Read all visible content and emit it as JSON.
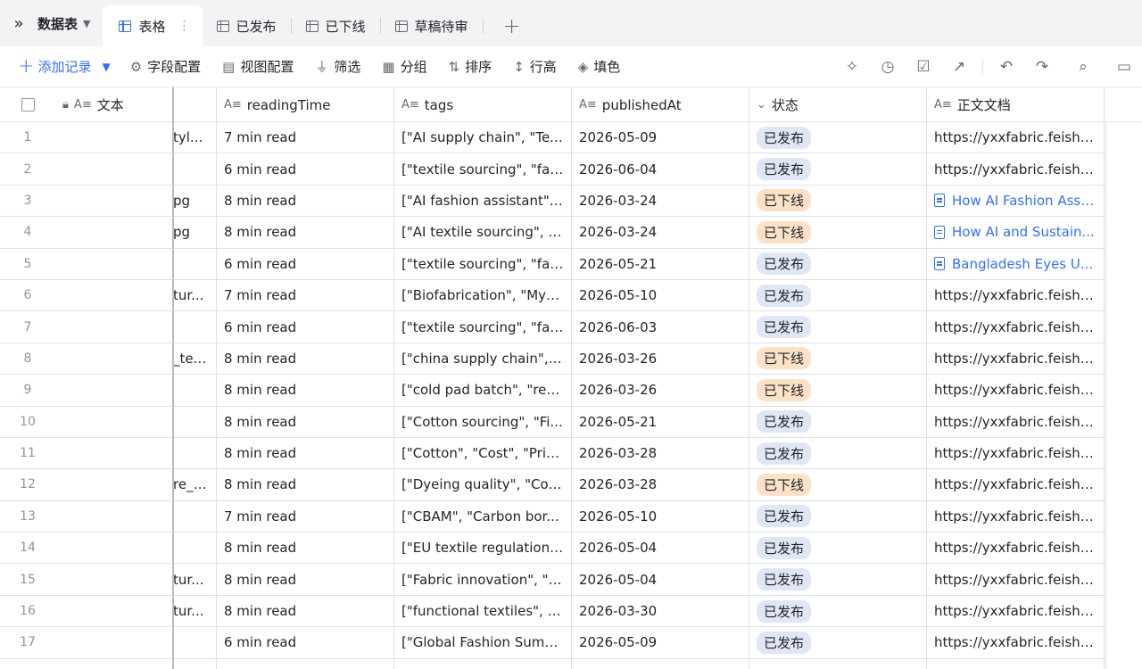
{
  "tabbar": {
    "expand_icon": "double-chevron-right-icon",
    "title": "数据表",
    "tabs": [
      {
        "label": "表格",
        "active": true
      },
      {
        "label": "已发布",
        "active": false
      },
      {
        "label": "已下线",
        "active": false
      },
      {
        "label": "草稿待审",
        "active": false
      }
    ],
    "add_icon": "plus-icon"
  },
  "toolbar": {
    "add_record": "添加记录",
    "buttons": [
      {
        "label": "字段配置",
        "icon": "gear-icon"
      },
      {
        "label": "视图配置",
        "icon": "view-config-icon"
      },
      {
        "label": "筛选",
        "icon": "filter-icon"
      },
      {
        "label": "分组",
        "icon": "group-icon"
      },
      {
        "label": "排序",
        "icon": "sort-icon"
      },
      {
        "label": "行高",
        "icon": "row-height-icon"
      },
      {
        "label": "填色",
        "icon": "fill-color-icon"
      }
    ],
    "right_icons": [
      "sparkle-icon",
      "history-icon",
      "checklist-icon",
      "share-icon",
      "undo-icon",
      "redo-icon",
      "search-icon",
      "comment-icon"
    ]
  },
  "columns": {
    "text": "文本",
    "readingTime": "readingTime",
    "tags": "tags",
    "publishedAt": "publishedAt",
    "state": "状态",
    "doc": "正文文档"
  },
  "colors": {
    "published_badge": "#e1e6f5",
    "offline_badge": "#fbe2c7",
    "accent": "#3370ff"
  },
  "rows": [
    {
      "n": "1",
      "clip": "tyl...",
      "read": "7 min read",
      "tags": "[\"AI supply chain\", \"Tex...",
      "pub": "2026-05-09",
      "state": "已发布",
      "kind": "published",
      "doc": "https://yxxfabric.feishu....",
      "doc_link": false
    },
    {
      "n": "2",
      "clip": "",
      "read": "6 min read",
      "tags": "[\"textile sourcing\", \"fab...",
      "pub": "2026-06-04",
      "state": "已发布",
      "kind": "published",
      "doc": "https://yxxfabric.feishu....",
      "doc_link": false
    },
    {
      "n": "3",
      "clip": "pg",
      "read": "8 min read",
      "tags": "[\"AI fashion assistant\", ...",
      "pub": "2026-03-24",
      "state": "已下线",
      "kind": "offline",
      "doc": "How AI Fashion Assi...",
      "doc_link": true
    },
    {
      "n": "4",
      "clip": "pg",
      "read": "8 min read",
      "tags": "[\"AI textile sourcing\", \"...",
      "pub": "2026-03-24",
      "state": "已下线",
      "kind": "offline",
      "doc": "How AI and Sustain...",
      "doc_link": true
    },
    {
      "n": "5",
      "clip": "",
      "read": "6 min read",
      "tags": "[\"textile sourcing\", \"fab...",
      "pub": "2026-05-21",
      "state": "已发布",
      "kind": "published",
      "doc": "Bangladesh Eyes U...",
      "doc_link": true
    },
    {
      "n": "6",
      "clip": "tur...",
      "read": "7 min read",
      "tags": "[\"Biofabrication\", \"Myc...",
      "pub": "2026-05-10",
      "state": "已发布",
      "kind": "published",
      "doc": "https://yxxfabric.feishu....",
      "doc_link": false
    },
    {
      "n": "7",
      "clip": "",
      "read": "6 min read",
      "tags": "[\"textile sourcing\", \"fab...",
      "pub": "2026-06-03",
      "state": "已发布",
      "kind": "published",
      "doc": "https://yxxfabric.feishu....",
      "doc_link": false
    },
    {
      "n": "8",
      "clip": "_tex...",
      "read": "8 min read",
      "tags": "[\"china supply chain\", \"...",
      "pub": "2026-03-26",
      "state": "已下线",
      "kind": "offline",
      "doc": "https://yxxfabric.feishu....",
      "doc_link": false
    },
    {
      "n": "9",
      "clip": "",
      "read": "8 min read",
      "tags": "[\"cold pad batch\", \"rea...",
      "pub": "2026-03-26",
      "state": "已下线",
      "kind": "offline",
      "doc": "https://yxxfabric.feishu....",
      "doc_link": false
    },
    {
      "n": "10",
      "clip": "",
      "read": "8 min read",
      "tags": "[\"Cotton sourcing\", \"Fi...",
      "pub": "2026-05-21",
      "state": "已发布",
      "kind": "published",
      "doc": "https://yxxfabric.feishu....",
      "doc_link": false
    },
    {
      "n": "11",
      "clip": "",
      "read": "8 min read",
      "tags": "[\"Cotton\", \"Cost\", \"Pric...",
      "pub": "2026-03-28",
      "state": "已发布",
      "kind": "published",
      "doc": "https://yxxfabric.feishu....",
      "doc_link": false
    },
    {
      "n": "12",
      "clip": "re_l...",
      "read": "8 min read",
      "tags": "[\"Dyeing quality\", \"Col...",
      "pub": "2026-03-28",
      "state": "已下线",
      "kind": "offline",
      "doc": "https://yxxfabric.feishu....",
      "doc_link": false
    },
    {
      "n": "13",
      "clip": "",
      "read": "7 min read",
      "tags": "[\"CBAM\", \"Carbon bor...",
      "pub": "2026-05-10",
      "state": "已发布",
      "kind": "published",
      "doc": "https://yxxfabric.feishu....",
      "doc_link": false
    },
    {
      "n": "14",
      "clip": "",
      "read": "8 min read",
      "tags": "[\"EU textile regulations...",
      "pub": "2026-05-04",
      "state": "已发布",
      "kind": "published",
      "doc": "https://yxxfabric.feishu....",
      "doc_link": false
    },
    {
      "n": "15",
      "clip": "tur...",
      "read": "8 min read",
      "tags": "[\"Fabric innovation\", \"S...",
      "pub": "2026-05-04",
      "state": "已发布",
      "kind": "published",
      "doc": "https://yxxfabric.feishu....",
      "doc_link": false
    },
    {
      "n": "16",
      "clip": "tur...",
      "read": "8 min read",
      "tags": "[\"functional textiles\", \"...",
      "pub": "2026-03-30",
      "state": "已发布",
      "kind": "published",
      "doc": "https://yxxfabric.feishu....",
      "doc_link": false
    },
    {
      "n": "17",
      "clip": "",
      "read": "6 min read",
      "tags": "[\"Global Fashion Summ...",
      "pub": "2026-05-09",
      "state": "已发布",
      "kind": "published",
      "doc": "https://yxxfabric.feishu....",
      "doc_link": false
    }
  ]
}
